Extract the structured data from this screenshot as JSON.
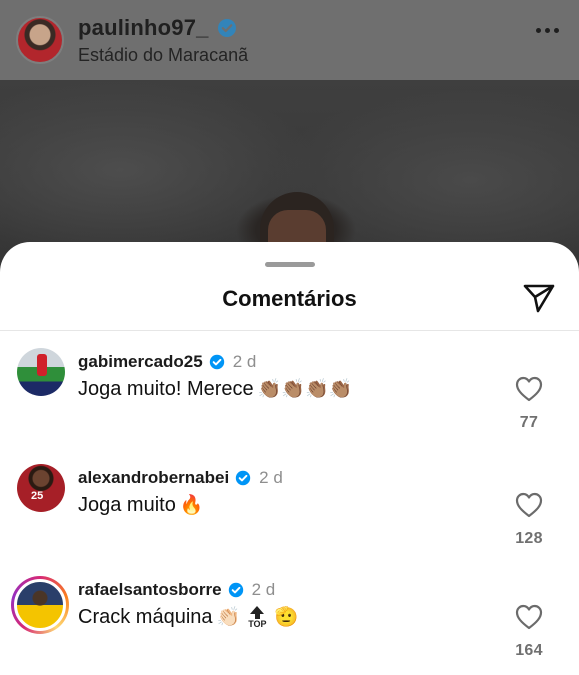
{
  "post": {
    "username": "paulinho97_",
    "location": "Estádio do Maracanã",
    "verified": true
  },
  "comments_sheet": {
    "title": "Comentários"
  },
  "comments": [
    {
      "username": "gabimercado25",
      "verified": true,
      "time": "2 d",
      "text": "Joga muito! Merece",
      "emojis": "👏🏽👏🏽👏🏽👏🏽",
      "likes": "77"
    },
    {
      "username": "alexandrobernabei",
      "verified": true,
      "time": "2 d",
      "text": "Joga muito",
      "emojis": "🔥",
      "likes": "128"
    },
    {
      "username": "rafaelsantosborre",
      "verified": true,
      "time": "2 d",
      "text": "Crack máquina",
      "emojis": "👏🏻",
      "top_label": "TOP",
      "emojis_after": "🫡",
      "likes": "164"
    }
  ],
  "colors": {
    "verified_blue": "#0095f6",
    "story_ring": "#d62976"
  },
  "icons": [
    "verified-badge-icon",
    "more-options-icon",
    "share-direct-icon",
    "heart-icon",
    "top-arrow-icon"
  ]
}
